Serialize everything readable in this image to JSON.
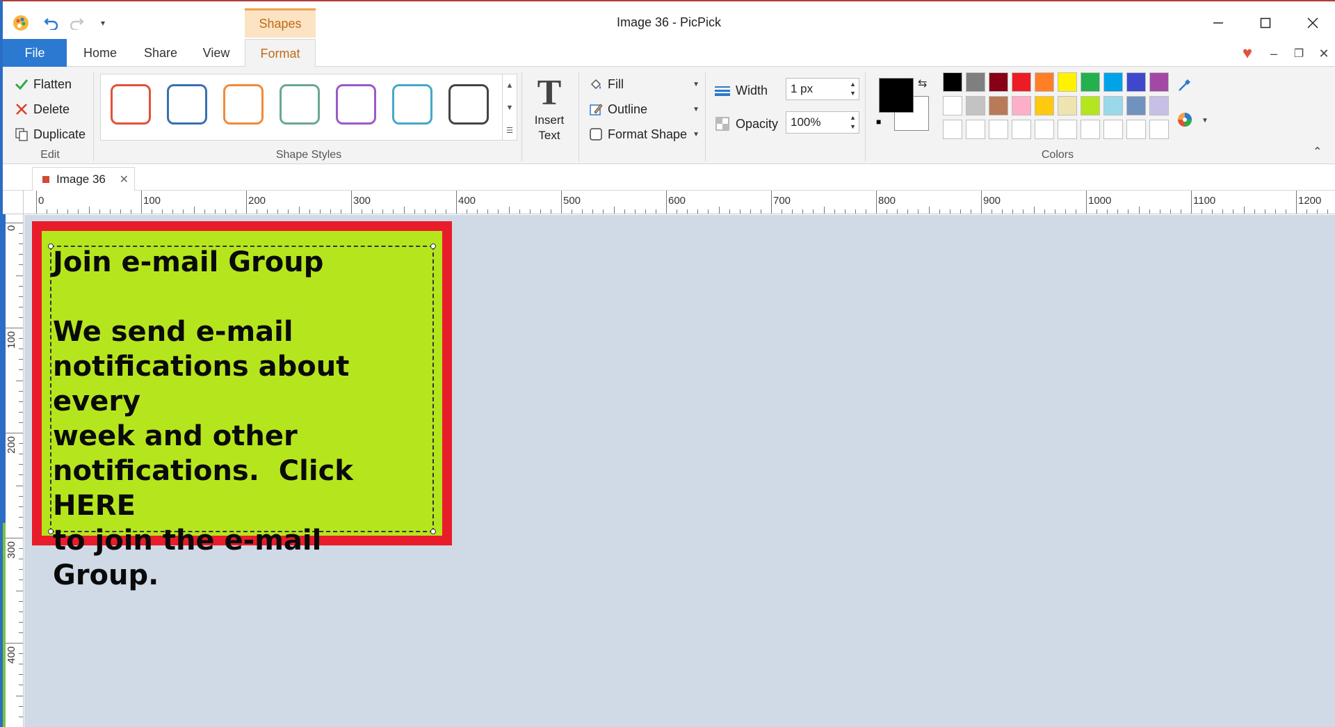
{
  "app": {
    "title": "Image 36 - PicPick"
  },
  "qat": {
    "more": "▾"
  },
  "contextual_tab": "Shapes",
  "tabs": [
    "File",
    "Home",
    "Share",
    "View",
    "Format"
  ],
  "active_tab": "Format",
  "ribbon": {
    "edit": {
      "flatten": "Flatten",
      "delete": "Delete",
      "duplicate": "Duplicate",
      "group_label": "Edit"
    },
    "shape_styles": {
      "group_label": "Shape Styles",
      "swatch_colors": [
        "#e0523a",
        "#3a6fb0",
        "#f08a3a",
        "#6aa88e",
        "#9b59c8",
        "#45a8c8",
        "#444444"
      ]
    },
    "insert_text": {
      "line1": "Insert",
      "line2": "Text"
    },
    "format": {
      "fill": "Fill",
      "outline": "Outline",
      "format_shape": "Format Shape"
    },
    "props": {
      "width_label": "Width",
      "width_value": "1 px",
      "opacity_label": "Opacity",
      "opacity_value": "100%"
    },
    "colors": {
      "group_label": "Colors",
      "foreground": "#000000",
      "background": "#ffffff",
      "palette_row1": [
        "#000000",
        "#7f7f7f",
        "#880015",
        "#ed1c24",
        "#ff7f27",
        "#fff200",
        "#22b14c",
        "#00a2e8",
        "#3f48cc",
        "#a349a4"
      ],
      "palette_row2": [
        "#ffffff",
        "#c3c3c3",
        "#b97a57",
        "#ffaec9",
        "#ffc90e",
        "#efe4b0",
        "#b5e61d",
        "#99d9ea",
        "#7092be",
        "#c8bfe7"
      ],
      "palette_row3": [
        "#ffffff",
        "#ffffff",
        "#ffffff",
        "#ffffff",
        "#ffffff",
        "#ffffff",
        "#ffffff",
        "#ffffff",
        "#ffffff",
        "#ffffff"
      ]
    }
  },
  "document_tab": {
    "label": "Image 36"
  },
  "ruler": {
    "h_labels": [
      "0",
      "100",
      "200",
      "300",
      "400",
      "500",
      "600",
      "700",
      "800",
      "900",
      "1000",
      "1100",
      "1200"
    ],
    "v_labels": [
      "0",
      "100",
      "200",
      "300",
      "400"
    ]
  },
  "canvas": {
    "background": "#d0dae6",
    "image": {
      "border_color": "#e81c2a",
      "fill_color": "#b5e61d",
      "text": "Join e-mail Group\n\nWe send e-mail\nnotifications about every\nweek and other\nnotifications.  Click HERE\nto join the e-mail Group."
    }
  }
}
